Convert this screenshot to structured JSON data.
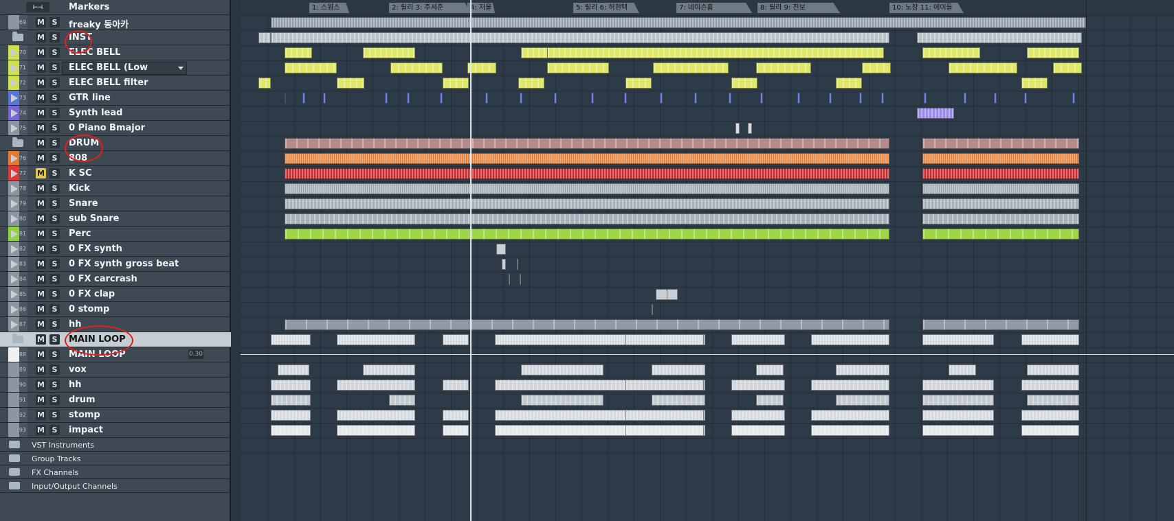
{
  "tracks": [
    {
      "id": "markers",
      "type": "marker",
      "name": "Markers",
      "color": "#8b96a0"
    },
    {
      "id": "freaky",
      "type": "audio",
      "num": "69",
      "name": "freaky 동아카",
      "color": "#8b96a0"
    },
    {
      "id": "inst",
      "type": "folder",
      "name": "INST",
      "color": "#8b96a0"
    },
    {
      "id": "t70",
      "type": "inst",
      "num": "70",
      "name": "ELEC BELL",
      "color": "#cfe04a"
    },
    {
      "id": "t71",
      "type": "inst",
      "num": "71",
      "name": "ELEC BELL (Low",
      "color": "#cfe04a"
    },
    {
      "id": "t72",
      "type": "inst",
      "num": "72",
      "name": "ELEC BELL filter",
      "color": "#cfe04a"
    },
    {
      "id": "t73",
      "type": "inst",
      "num": "73",
      "name": "GTR line",
      "color": "#5a77d6"
    },
    {
      "id": "t74",
      "type": "inst",
      "num": "74",
      "name": "Synth lead",
      "color": "#7b66d8"
    },
    {
      "id": "t75",
      "type": "inst",
      "num": "75",
      "name": "0 Piano Bmajor",
      "color": "#8b96a0"
    },
    {
      "id": "drum",
      "type": "folder",
      "name": "DRUM",
      "color": "#8b96a0"
    },
    {
      "id": "t76",
      "type": "inst",
      "num": "76",
      "name": "808",
      "color": "#e57a2e"
    },
    {
      "id": "t77",
      "type": "inst",
      "num": "77",
      "name": "K SC",
      "color": "#e03838"
    },
    {
      "id": "t78",
      "type": "inst",
      "num": "78",
      "name": "Kick",
      "color": "#8b96a0"
    },
    {
      "id": "t79",
      "type": "inst",
      "num": "79",
      "name": "Snare",
      "color": "#8b96a0"
    },
    {
      "id": "t80",
      "type": "inst",
      "num": "80",
      "name": "sub Snare",
      "color": "#8b96a0"
    },
    {
      "id": "t81",
      "type": "inst",
      "num": "81",
      "name": "Perc",
      "color": "#8fd43a"
    },
    {
      "id": "t82",
      "type": "inst",
      "num": "82",
      "name": "0 FX synth",
      "color": "#8b96a0"
    },
    {
      "id": "t83",
      "type": "inst",
      "num": "83",
      "name": "0 FX synth gross beat",
      "color": "#8b96a0"
    },
    {
      "id": "t84",
      "type": "inst",
      "num": "84",
      "name": "0 FX carcrash",
      "color": "#8b96a0"
    },
    {
      "id": "t85",
      "type": "inst",
      "num": "85",
      "name": "0 FX clap",
      "color": "#8b96a0"
    },
    {
      "id": "t86",
      "type": "inst",
      "num": "86",
      "name": "0 stomp",
      "color": "#8b96a0"
    },
    {
      "id": "t87",
      "type": "inst",
      "num": "87",
      "name": "hh",
      "color": "#8b96a0"
    },
    {
      "id": "mainloop",
      "type": "folder",
      "name": "MAIN LOOP",
      "color": "#8b96a0"
    },
    {
      "id": "t88",
      "type": "audio",
      "num": "88",
      "name": "MAIN LOOP",
      "color": "#f0f0f0",
      "value": "0.30"
    },
    {
      "id": "t89",
      "type": "audio",
      "num": "89",
      "name": "vox",
      "color": "#8b96a0"
    },
    {
      "id": "t90",
      "type": "audio",
      "num": "90",
      "name": "hh",
      "color": "#8b96a0"
    },
    {
      "id": "t91",
      "type": "audio",
      "num": "91",
      "name": "drum",
      "color": "#8b96a0"
    },
    {
      "id": "t92",
      "type": "audio",
      "num": "92",
      "name": "stomp",
      "color": "#8b96a0"
    },
    {
      "id": "t93",
      "type": "audio",
      "num": "93",
      "name": "impact",
      "color": "#8b96a0"
    }
  ],
  "mute_label": "M",
  "solo_label": "S",
  "folders_bottom": [
    "VST Instruments",
    "Group Tracks",
    "FX Channels",
    "Input/Output Channels"
  ],
  "markers": [
    {
      "label": "1: 스윙스"
    },
    {
      "label": "2: 릴리 3: 주셔준"
    },
    {
      "label": "4: 저울"
    },
    {
      "label": "5: 릴리 6: 허현택"
    },
    {
      "label": "7: 네이슨홈"
    },
    {
      "label": "8: 릴리 9: 진보"
    },
    {
      "label": "10: 노창 11: 에이들"
    }
  ],
  "annotations": [
    "INST",
    "DRUM",
    "MAIN LOOP"
  ]
}
